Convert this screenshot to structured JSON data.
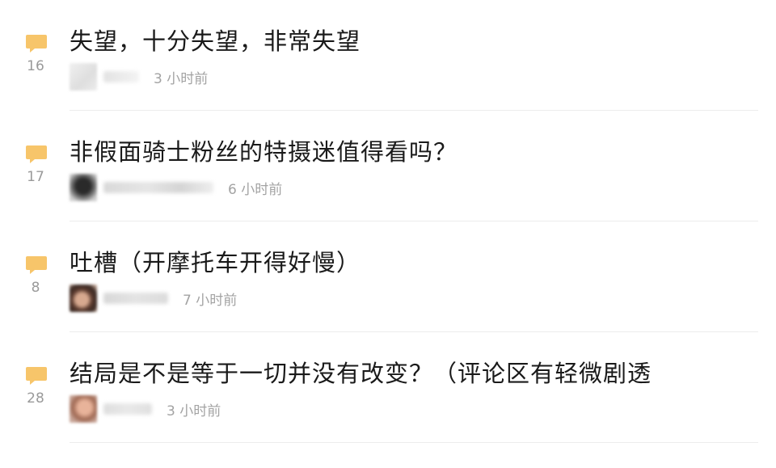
{
  "colors": {
    "bubble": "#f7c56a",
    "count": "#9a9a9a",
    "title": "#1a1a1a",
    "time": "#a3a3a3",
    "divider": "#ececec"
  },
  "threads": [
    {
      "reply_count": "16",
      "title": "失望，十分失望，非常失望",
      "time": "3 小时前",
      "avatar_icon": "blurred-avatar"
    },
    {
      "reply_count": "17",
      "title": "非假面骑士粉丝的特摄迷值得看吗？",
      "time": "6 小时前",
      "avatar_icon": "blurred-avatar"
    },
    {
      "reply_count": "8",
      "title": "吐槽（开摩托车开得好慢）",
      "time": "7 小时前",
      "avatar_icon": "blurred-avatar"
    },
    {
      "reply_count": "28",
      "title": "结局是不是等于一切并没有改变？（评论区有轻微剧透",
      "time": "3 小时前",
      "avatar_icon": "blurred-avatar"
    }
  ]
}
